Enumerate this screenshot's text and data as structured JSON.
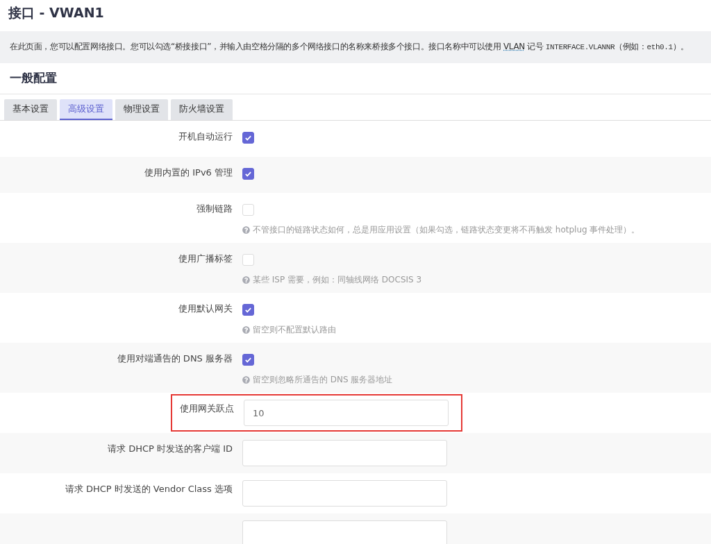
{
  "page_title": "接口 - VWAN1",
  "description": [
    {
      "kind": "text",
      "text": "在此页面，您可以配置网络接口。您可以勾选“桥接接口”，并输入由空格分隔的多个网络接口的名称来桥接多个接口。接口名称中可以使用 "
    },
    {
      "kind": "abbr",
      "text": "VLAN"
    },
    {
      "kind": "text",
      "text": " 记号 "
    },
    {
      "kind": "code",
      "text": "INTERFACE.VLANNR"
    },
    {
      "kind": "text",
      "text": "（例如："
    },
    {
      "kind": "code",
      "text": "eth0.1"
    },
    {
      "kind": "text",
      "text": "）。"
    }
  ],
  "section_title": "一般配置",
  "tabs": [
    {
      "label": "基本设置",
      "selected": false
    },
    {
      "label": "高级设置",
      "selected": true
    },
    {
      "label": "物理设置",
      "selected": false
    },
    {
      "label": "防火墙设置",
      "selected": false
    }
  ],
  "rows": [
    {
      "kind": "checkbox",
      "label": "开机自动运行",
      "checked": true,
      "highlighted": false
    },
    {
      "kind": "checkbox",
      "label": "使用内置的 IPv6 管理",
      "checked": true,
      "highlighted": false
    },
    {
      "kind": "checkbox",
      "label": "强制链路",
      "checked": false,
      "hint": "不管接口的链路状态如何，总是用应用设置（如果勾选，链路状态变更将不再触发 hotplug 事件处理）。",
      "highlighted": false
    },
    {
      "kind": "checkbox",
      "label": "使用广播标签",
      "checked": false,
      "hint": "某些 ISP 需要，例如：同轴线网络 DOCSIS 3",
      "highlighted": false
    },
    {
      "kind": "checkbox",
      "label": "使用默认网关",
      "checked": true,
      "hint": "留空则不配置默认路由",
      "highlighted": false
    },
    {
      "kind": "checkbox",
      "label": "使用对端通告的 DNS 服务器",
      "checked": true,
      "hint": "留空则忽略所通告的 DNS 服务器地址",
      "highlighted": false
    },
    {
      "kind": "text",
      "label": "使用网关跃点",
      "value": "10",
      "highlighted": true
    },
    {
      "kind": "text",
      "label": "请求 DHCP 时发送的客户端 ID",
      "highlighted": false
    },
    {
      "kind": "text",
      "label": "请求 DHCP 时发送的 Vendor Class 选项",
      "highlighted": false
    },
    {
      "kind": "text",
      "highlighted": false
    }
  ]
}
